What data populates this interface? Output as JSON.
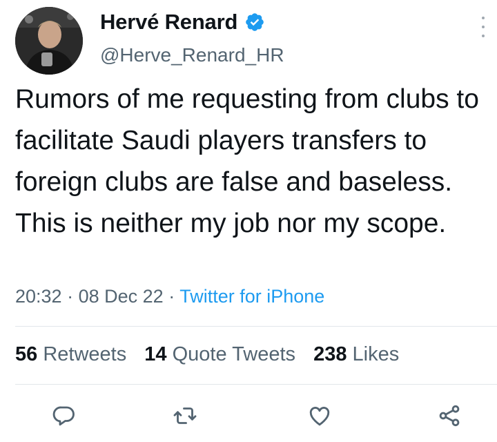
{
  "author": {
    "display_name": "Hervé Renard",
    "handle": "@Herve_Renard_HR",
    "avatar_icon": "profile-photo",
    "verified_icon": "verified-badge-icon",
    "verified_color": "#1d9bf0"
  },
  "tweet": {
    "text": "Rumors of me requesting from clubs to facilitate Saudi players transfers to foreign clubs are false and baseless. This is neither my job nor my scope.",
    "time": "20:32",
    "date": "08 Dec 22",
    "separator": "·",
    "source": "Twitter for iPhone"
  },
  "stats": {
    "retweets_count": "56",
    "retweets_label": "Retweets",
    "quotes_count": "14",
    "quotes_label": "Quote Tweets",
    "likes_count": "238",
    "likes_label": "Likes"
  },
  "actions": [
    "reply-icon",
    "retweet-icon",
    "like-icon",
    "share-icon"
  ],
  "colors": {
    "text": "#0f1419",
    "secondary": "#536471",
    "link": "#1d9bf0",
    "divider": "#e1e6ea"
  }
}
